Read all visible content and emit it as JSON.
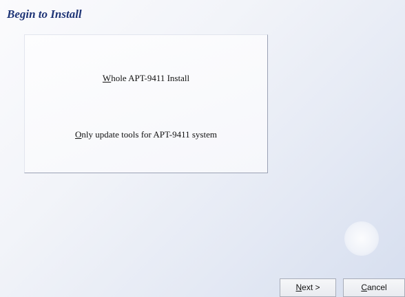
{
  "header": {
    "title": "Begin to Install"
  },
  "options": {
    "whole_install": {
      "accel": "W",
      "rest": "hole APT-9411 Install"
    },
    "update_tools": {
      "accel": "O",
      "rest": "nly update tools for APT-9411 system"
    }
  },
  "buttons": {
    "next": {
      "accel": "N",
      "rest": "ext >"
    },
    "cancel": {
      "accel": "C",
      "rest": "ancel"
    }
  },
  "colors": {
    "title": "#1f3576",
    "background": "#eef1f8"
  }
}
